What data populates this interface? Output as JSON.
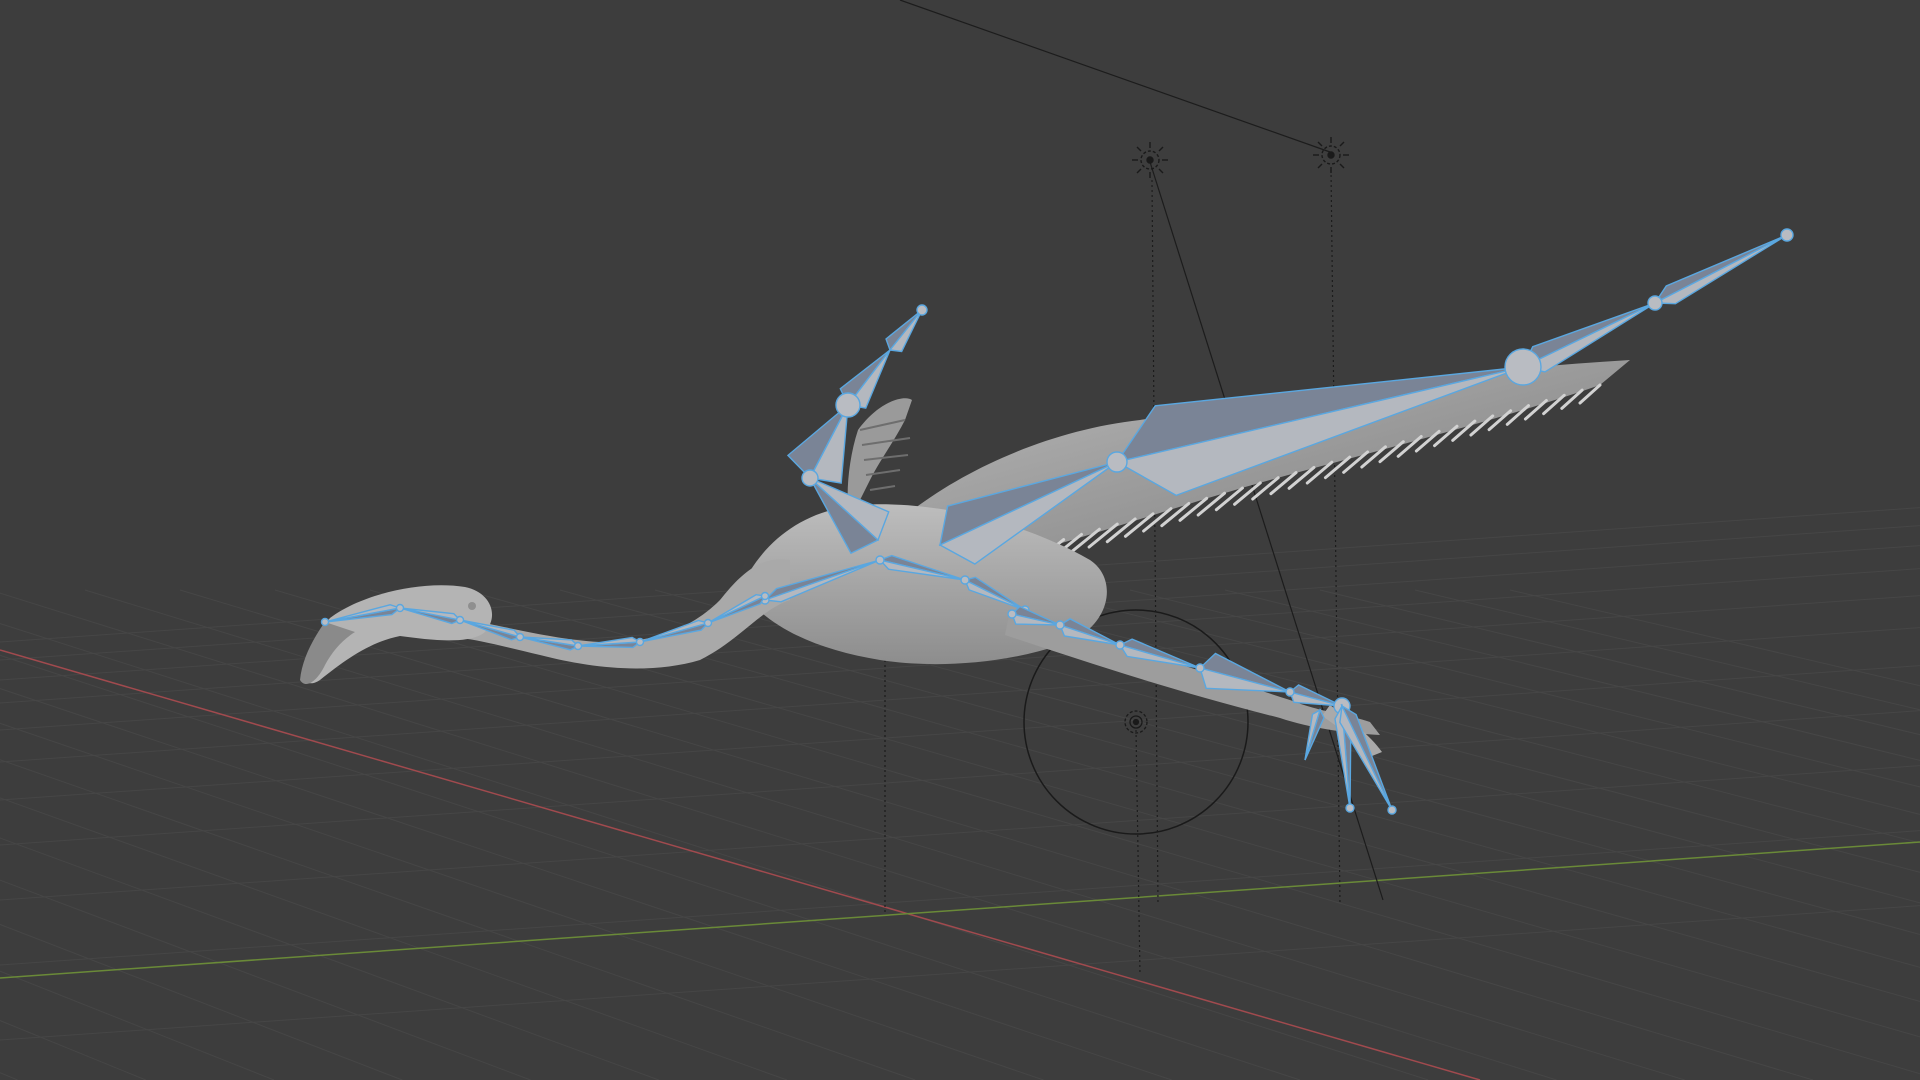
{
  "viewport": {
    "background": "#3d3d3d",
    "grid_color": "#474747",
    "x_axis_color": "#a84b4f",
    "y_axis_color": "#6f8f3a",
    "mesh_fill": "#a9a9a9",
    "mesh_shadow": "#8a8a8a",
    "bone_fill": "#b5b8bd",
    "bone_dark": "#7c8494",
    "bone_outline": "#4d9cd6",
    "helper_line_color": "#1f1f1f"
  },
  "icons": {
    "light_1": "sun-light-icon",
    "light_2": "sun-light-icon",
    "light_3": "point-light-icon"
  }
}
